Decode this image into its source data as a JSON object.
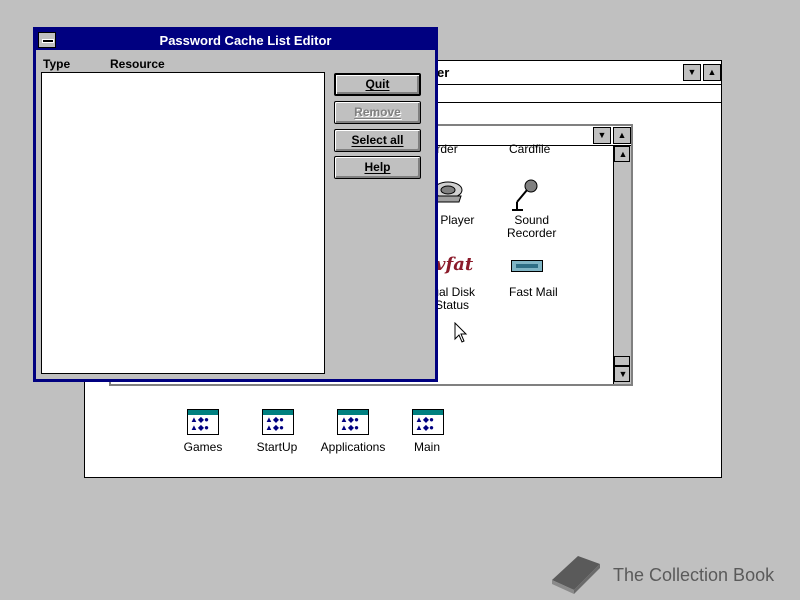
{
  "program_manager": {
    "title_partial": "er",
    "group_window": {
      "icons": [
        {
          "label": "ecorder",
          "icon": "recorder-icon"
        },
        {
          "label": "Cardfile",
          "icon": "cardfile-icon"
        },
        {
          "label": "dia Player",
          "icon": "media-player-icon"
        },
        {
          "label": "Sound\nRecorder",
          "icon": "microphone-icon"
        },
        {
          "label": "tual Disk\nStatus",
          "icon": "vfat-icon",
          "icon_text": "vfat"
        },
        {
          "label": "Fast Mail",
          "icon": "fast-mail-icon"
        }
      ]
    },
    "group_icons": [
      {
        "label": "Games"
      },
      {
        "label": "StartUp"
      },
      {
        "label": "Applications"
      },
      {
        "label": "Main"
      }
    ]
  },
  "password_cache": {
    "title": "Password Cache List Editor",
    "columns": {
      "type": "Type",
      "resource": "Resource"
    },
    "entries": [],
    "buttons": {
      "quit": "Quit",
      "remove": "Remove",
      "select_all": "Select all",
      "help": "Help"
    }
  },
  "watermark": {
    "text": "The Collection Book"
  },
  "colors": {
    "titlebar_active": "#000080",
    "desktop": "#c0c0c0"
  }
}
